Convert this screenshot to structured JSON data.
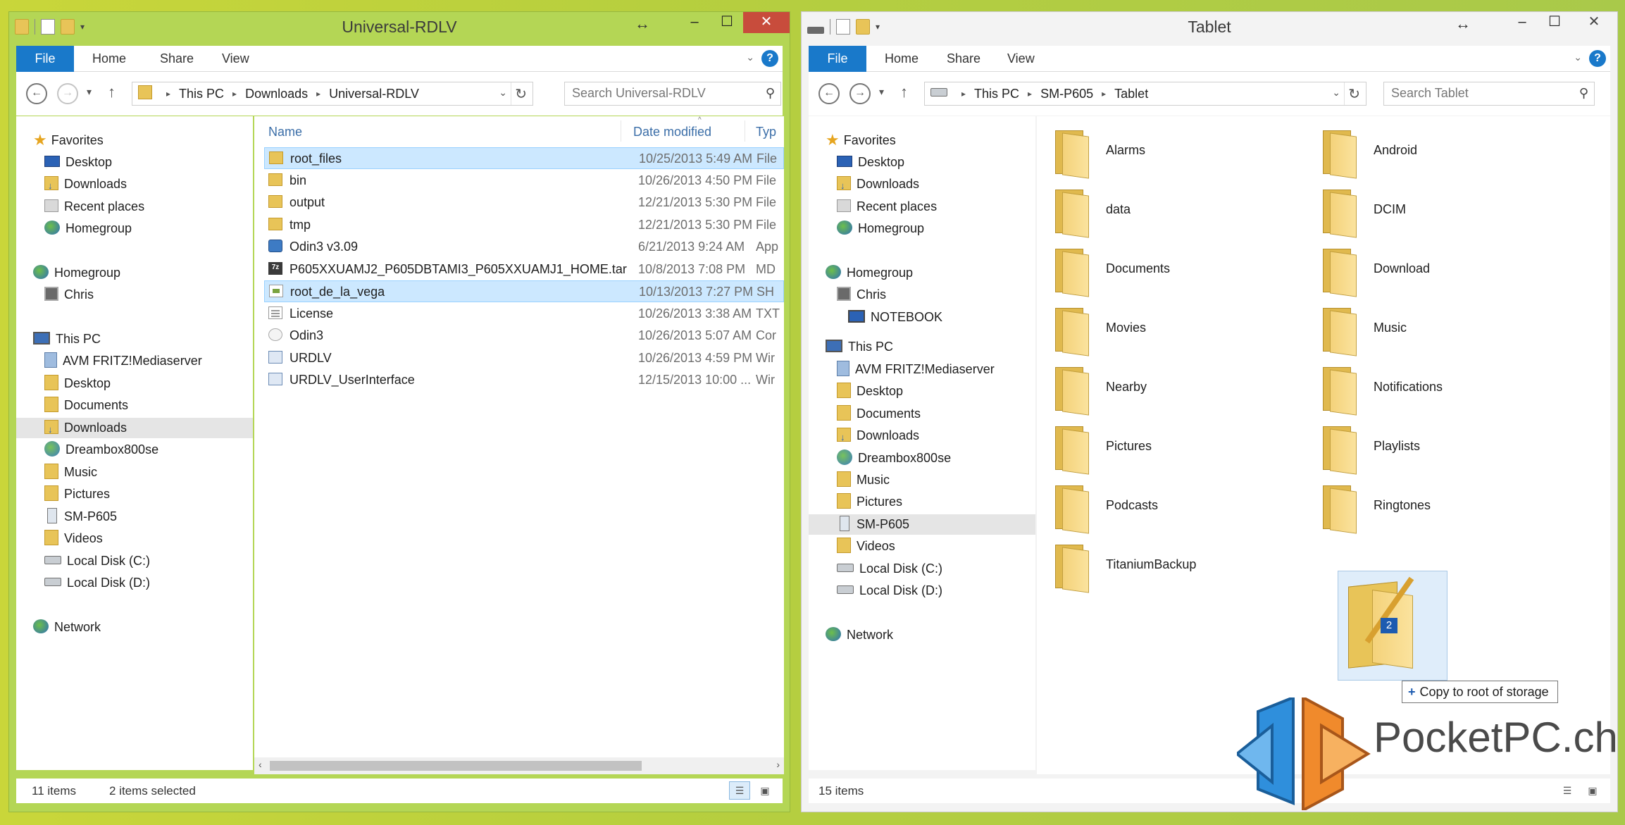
{
  "left": {
    "title": "Universal-RDLV",
    "ribbon": {
      "file": "File",
      "home": "Home",
      "share": "Share",
      "view": "View"
    },
    "address": [
      "This PC",
      "Downloads",
      "Universal-RDLV"
    ],
    "search_placeholder": "Search Universal-RDLV",
    "columns": {
      "name": "Name",
      "date": "Date modified",
      "type": "Typ"
    },
    "nav": {
      "favorites": "Favorites",
      "desktop": "Desktop",
      "downloads": "Downloads",
      "recent": "Recent places",
      "homegroup_fav": "Homegroup",
      "homegroup": "Homegroup",
      "chris": "Chris",
      "thispc": "This PC",
      "avm": "AVM FRITZ!Mediaserver",
      "pc_desktop": "Desktop",
      "documents": "Documents",
      "pc_downloads": "Downloads",
      "dreambox": "Dreambox800se",
      "music": "Music",
      "pictures": "Pictures",
      "smp605": "SM-P605",
      "videos": "Videos",
      "diskc": "Local Disk (C:)",
      "diskd": "Local Disk (D:)",
      "network": "Network"
    },
    "files": [
      {
        "name": "root_files",
        "date": "10/25/2013 5:49 AM",
        "type": "File",
        "icon": "folder",
        "selected": true
      },
      {
        "name": "bin",
        "date": "10/26/2013 4:50 PM",
        "type": "File",
        "icon": "folder",
        "selected": false
      },
      {
        "name": "output",
        "date": "12/21/2013 5:30 PM",
        "type": "File",
        "icon": "folder",
        "selected": false
      },
      {
        "name": "tmp",
        "date": "12/21/2013 5:30 PM",
        "type": "File",
        "icon": "folder",
        "selected": false
      },
      {
        "name": "Odin3 v3.09",
        "date": "6/21/2013 9:24 AM",
        "type": "App",
        "icon": "app",
        "selected": false
      },
      {
        "name": "P605XXUAMJ2_P605DBTAMI3_P605XXUAMJ1_HOME.tar",
        "date": "10/8/2013 7:08 PM",
        "type": "MD",
        "icon": "tar",
        "selected": false
      },
      {
        "name": "root_de_la_vega",
        "date": "10/13/2013 7:27 PM",
        "type": "SH",
        "icon": "script",
        "selected": true
      },
      {
        "name": "License",
        "date": "10/26/2013 3:38 AM",
        "type": "TXT",
        "icon": "text",
        "selected": false
      },
      {
        "name": "Odin3",
        "date": "10/26/2013 5:07 AM",
        "type": "Cor",
        "icon": "cfg",
        "selected": false
      },
      {
        "name": "URDLV",
        "date": "10/26/2013 4:59 PM",
        "type": "Wir",
        "icon": "win",
        "selected": false
      },
      {
        "name": "URDLV_UserInterface",
        "date": "12/15/2013 10:00 ...",
        "type": "Wir",
        "icon": "win",
        "selected": false
      }
    ],
    "status_count": "11 items",
    "status_selected": "2 items selected"
  },
  "right": {
    "title": "Tablet",
    "ribbon": {
      "file": "File",
      "home": "Home",
      "share": "Share",
      "view": "View"
    },
    "address": [
      "This PC",
      "SM-P605",
      "Tablet"
    ],
    "search_placeholder": "Search Tablet",
    "nav": {
      "favorites": "Favorites",
      "desktop": "Desktop",
      "downloads": "Downloads",
      "recent": "Recent places",
      "homegroup_fav": "Homegroup",
      "homegroup": "Homegroup",
      "chris": "Chris",
      "notebook": "NOTEBOOK",
      "thispc": "This PC",
      "avm": "AVM FRITZ!Mediaserver",
      "pc_desktop": "Desktop",
      "documents": "Documents",
      "pc_downloads": "Downloads",
      "dreambox": "Dreambox800se",
      "music": "Music",
      "pictures": "Pictures",
      "smp605": "SM-P605",
      "videos": "Videos",
      "diskc": "Local Disk (C:)",
      "diskd": "Local Disk (D:)",
      "network": "Network"
    },
    "folders": [
      "Alarms",
      "Android",
      "data",
      "DCIM",
      "Documents",
      "Download",
      "Movies",
      "Music",
      "Nearby",
      "Notifications",
      "Pictures",
      "Playlists",
      "Podcasts",
      "Ringtones",
      "TitaniumBackup"
    ],
    "status_count": "15 items"
  },
  "drag": {
    "count": "2",
    "tooltip": "Copy to root of storage"
  },
  "watermark": "PocketPC.ch",
  "colors": {
    "accent": "#1979ca",
    "selection": "#cce8ff",
    "frame_active": "#b4d655"
  }
}
